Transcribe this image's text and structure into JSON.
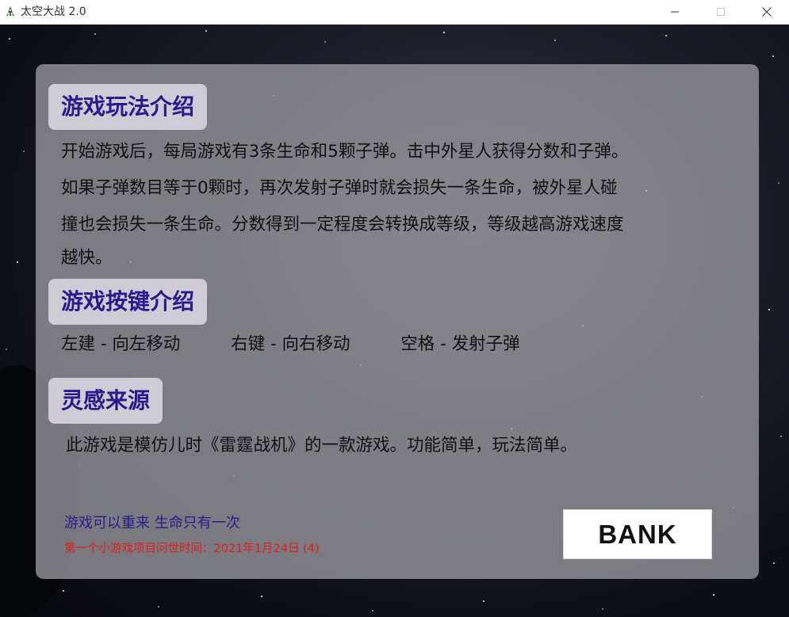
{
  "window": {
    "title": "太空大战 2.0",
    "icon": "rocket-icon",
    "controls": [
      "minimize-icon",
      "maximize-icon",
      "close-icon"
    ]
  },
  "colors": {
    "title_accent": "#2a1a8c",
    "red_note": "#e21d1d",
    "panel": "#a5a3aa"
  },
  "sections": {
    "gameplay": {
      "title": "游戏玩法介绍",
      "lines": [
        "开始游戏后，每局游戏有3条生命和5颗子弹。击中外星人获得分数和子弹。",
        "如果子弹数目等于0颗时，再次发射子弹时就会损失一条生命，被外星人碰",
        "撞也会损失一条生命。分数得到一定程度会转换成等级，等级越高游戏速度",
        "越快。"
      ]
    },
    "keys": {
      "title": "游戏按键介绍",
      "items": [
        "左建 - 向左移动",
        "右键 - 向右移动",
        "空格 - 发射子弹"
      ]
    },
    "inspiration": {
      "title": "灵感来源",
      "text": "此游戏是模仿儿时《雷霆战机》的一款游戏。功能简单，玩法简单。"
    }
  },
  "footer": {
    "note": "游戏可以重来 生命只有一次",
    "release": "第一个小游戏项目问世时间：2021年1月24日 (4)"
  },
  "bank_button": {
    "label": "BANK"
  }
}
